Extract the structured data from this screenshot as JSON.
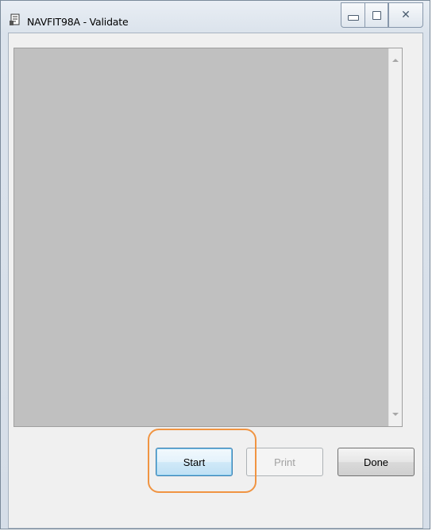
{
  "window": {
    "title": "NAVFIT98A - Validate",
    "close_glyph": "✕"
  },
  "output": {
    "text": ""
  },
  "buttons": {
    "start": "Start",
    "print": "Print",
    "done": "Done"
  },
  "icons": {
    "app": "app-document-icon",
    "minimize": "minimize-icon",
    "maximize": "maximize-icon",
    "close": "close-icon"
  },
  "colors": {
    "highlight": "#f09442",
    "output_background": "#c0c0c0"
  },
  "states": {
    "print_enabled": false
  }
}
